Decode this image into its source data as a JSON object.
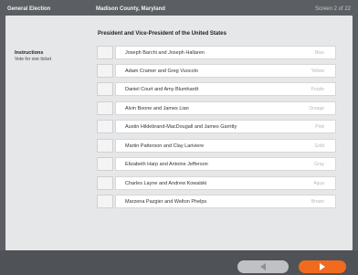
{
  "header": {
    "election": "General Election",
    "county": "Madison County, Maryland",
    "screen": "Screen 2 of 22"
  },
  "contest": {
    "title": "President and Vice-President of the United States"
  },
  "instructions": {
    "title": "Instructions",
    "body": "Vote for one ticket"
  },
  "candidates": [
    {
      "name": "Joseph Barchi and Joseph Hallaren",
      "party": "Blue"
    },
    {
      "name": "Adam Cramer and Greg Vuocolo",
      "party": "Yellow"
    },
    {
      "name": "Daniel Court and Amy Blumhardt",
      "party": "Purple"
    },
    {
      "name": "Alvin Boone and James Lian",
      "party": "Orange"
    },
    {
      "name": "Austin Hildebrand-MacDougall and James Garritty",
      "party": "Pink"
    },
    {
      "name": "Martin Patterson and Clay Lariviere",
      "party": "Gold"
    },
    {
      "name": "Elizabeth Harp and Antoine Jefferson",
      "party": "Gray"
    },
    {
      "name": "Charles Layne and Andrew Kowalski",
      "party": "Aqua"
    },
    {
      "name": "Marzena Pazgier and Welton Phelps",
      "party": "Brown"
    }
  ],
  "navigation": {
    "back_icon": "back-arrow-icon",
    "next_icon": "next-arrow-icon",
    "next_color": "#f06a1f"
  }
}
